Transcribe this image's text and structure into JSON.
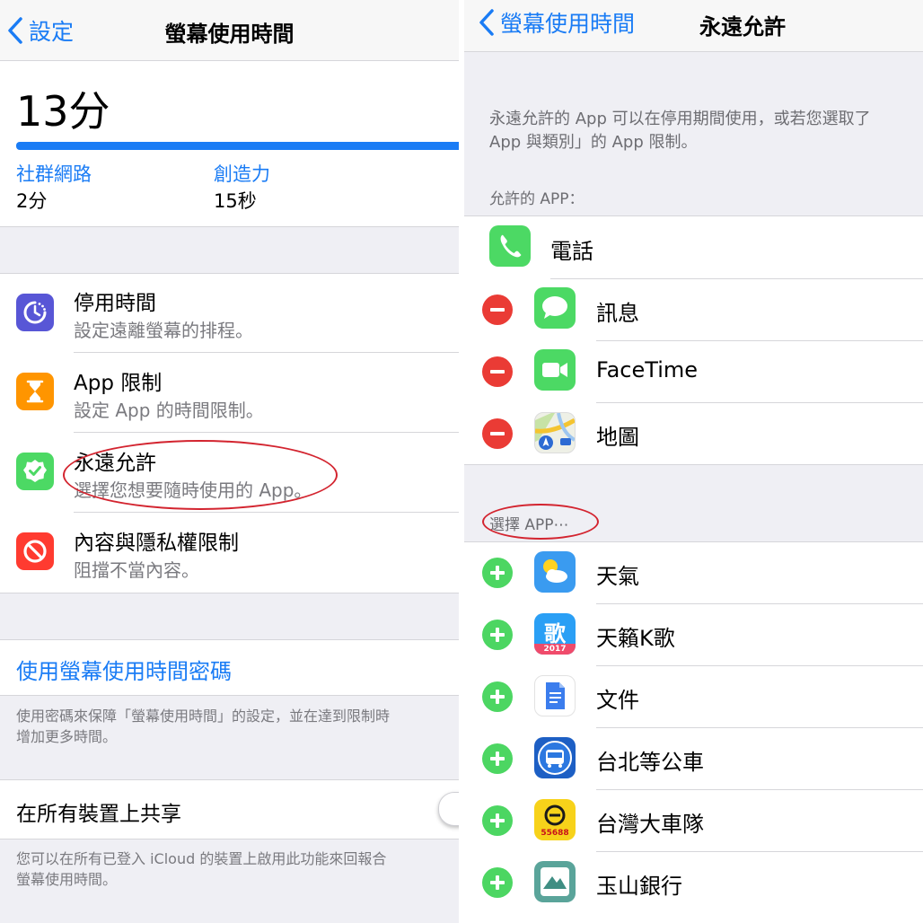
{
  "left": {
    "nav": {
      "back_label": "設定",
      "title": "螢幕使用時間"
    },
    "summary": {
      "total_time": "13分",
      "categories": [
        {
          "name": "社群網路",
          "value": "2分"
        },
        {
          "name": "創造力",
          "value": "15秒"
        }
      ]
    },
    "settings": [
      {
        "title": "停用時間",
        "subtitle": "設定遠離螢幕的排程。",
        "icon": "downtime-icon",
        "color": "#5856d6"
      },
      {
        "title": "App 限制",
        "subtitle": "設定 App 的時間限制。",
        "icon": "hourglass-icon",
        "color": "#ff9500"
      },
      {
        "title": "永遠允許",
        "subtitle": "選擇您想要隨時使用的 App。",
        "icon": "checkmark-badge-icon",
        "color": "#4cd964"
      },
      {
        "title": "內容與隱私權限制",
        "subtitle": "阻擋不當內容。",
        "icon": "no-entry-icon",
        "color": "#ff3b30"
      }
    ],
    "passcode": {
      "link_label": "使用螢幕使用時間密碼",
      "footnote_line1": "使用密碼來保障「螢幕使用時間」的設定，並在達到限制時",
      "footnote_line2": "增加更多時間。"
    },
    "share": {
      "label": "在所有裝置上共享",
      "footnote_line1": "您可以在所有已登入 iCloud 的裝置上啟用此功能來回報合",
      "footnote_line2": "螢幕使用時間。"
    }
  },
  "right": {
    "nav": {
      "back_label": "螢幕使用時間",
      "title": "永遠允許"
    },
    "intro_line1": "永遠允許的 App 可以在停用期間使用，或若您選取了",
    "intro_line2": "App 與類別」的 App 限制。",
    "allowed_header": "允許的 APP：",
    "allowed_apps": [
      {
        "name": "電話",
        "icon": "phone-icon"
      },
      {
        "name": "訊息",
        "icon": "messages-icon"
      },
      {
        "name": "FaceTime",
        "icon": "facetime-icon"
      },
      {
        "name": "地圖",
        "icon": "maps-icon"
      }
    ],
    "choose_header": "選擇 APP⋯",
    "choose_apps": [
      {
        "name": "天氣",
        "icon": "weather-icon"
      },
      {
        "name": "天籟K歌",
        "icon": "karaoke-icon",
        "icon_text": "歌",
        "icon_year": "2017"
      },
      {
        "name": "文件",
        "icon": "docs-icon"
      },
      {
        "name": "台北等公車",
        "icon": "bus-icon"
      },
      {
        "name": "台灣大車隊",
        "icon": "taxi-icon",
        "icon_text": "55688"
      },
      {
        "name": "玉山銀行",
        "icon": "bank-icon"
      }
    ]
  },
  "colors": {
    "tint": "#1a7cf5",
    "highlight": "#d3242f",
    "remove": "#ea3b35",
    "add": "#4cd662"
  }
}
